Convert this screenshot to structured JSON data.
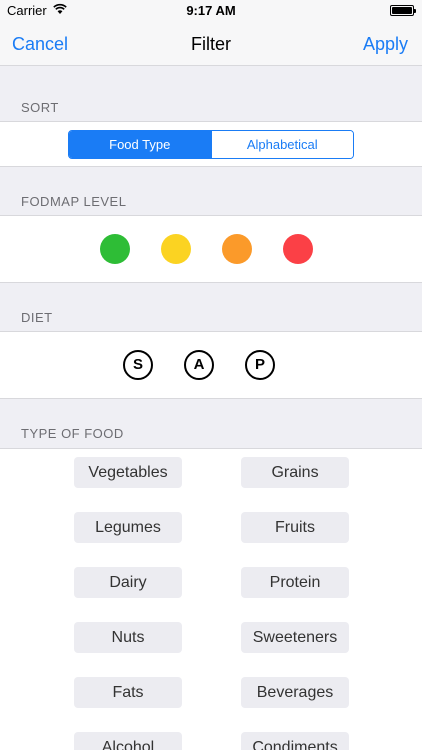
{
  "status_bar": {
    "carrier": "Carrier",
    "wifi_icon": "wifi-icon",
    "time": "9:17 AM",
    "battery_icon": "battery-icon"
  },
  "nav": {
    "cancel": "Cancel",
    "title": "Filter",
    "apply": "Apply"
  },
  "sort": {
    "header": "SORT",
    "options": [
      "Food Type",
      "Alphabetical"
    ],
    "selected": "Food Type",
    "accent": "#1a7cf5"
  },
  "fodmap": {
    "header": "FODMAP LEVEL",
    "levels": [
      {
        "name": "green",
        "color": "#2ebd36"
      },
      {
        "name": "yellow",
        "color": "#fbd322"
      },
      {
        "name": "orange",
        "color": "#fb9a2a"
      },
      {
        "name": "red",
        "color": "#fb4046"
      }
    ]
  },
  "diet": {
    "header": "DIET",
    "badges": [
      "S",
      "A",
      "P"
    ]
  },
  "type_of_food": {
    "header": "TYPE OF FOOD",
    "items": [
      [
        "Vegetables",
        "Grains"
      ],
      [
        "Legumes",
        "Fruits"
      ],
      [
        "Dairy",
        "Protein"
      ],
      [
        "Nuts",
        "Sweeteners"
      ],
      [
        "Fats",
        "Beverages"
      ],
      [
        "Alcohol",
        "Condiments"
      ]
    ]
  }
}
